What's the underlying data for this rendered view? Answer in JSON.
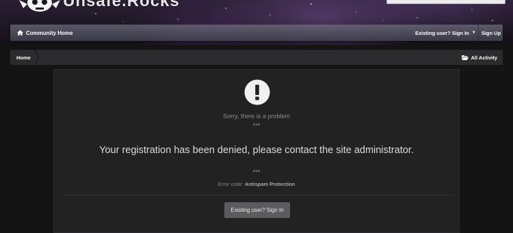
{
  "header": {
    "site_name": "Unsafe.Rocks",
    "logo_icon": "robot-skull-icon"
  },
  "navbar": {
    "home_label": "Community Home",
    "home_icon": "home-icon",
    "signin_label": "Existing user? Sign In",
    "signin_caret_icon": "caret-down-icon",
    "signup_label": "Sign Up"
  },
  "breadcrumb": {
    "home_label": "Home",
    "activity_label": "All Activity",
    "activity_icon": "folder-open-icon"
  },
  "error": {
    "icon": "exclamation-circle-icon",
    "title": "Sorry, there is a problem",
    "stars_top": "***",
    "message": "Your registration has been denied, please contact the site administrator.",
    "stars_bottom": "***",
    "code_prefix": "Error code:",
    "code_value": "Antispam Protection",
    "button_label": "Existing user? Sign In"
  },
  "colors": {
    "background": "#141414",
    "panel": "#222223",
    "button": "#5c5c5e",
    "navbar": "#5e5e6c"
  }
}
